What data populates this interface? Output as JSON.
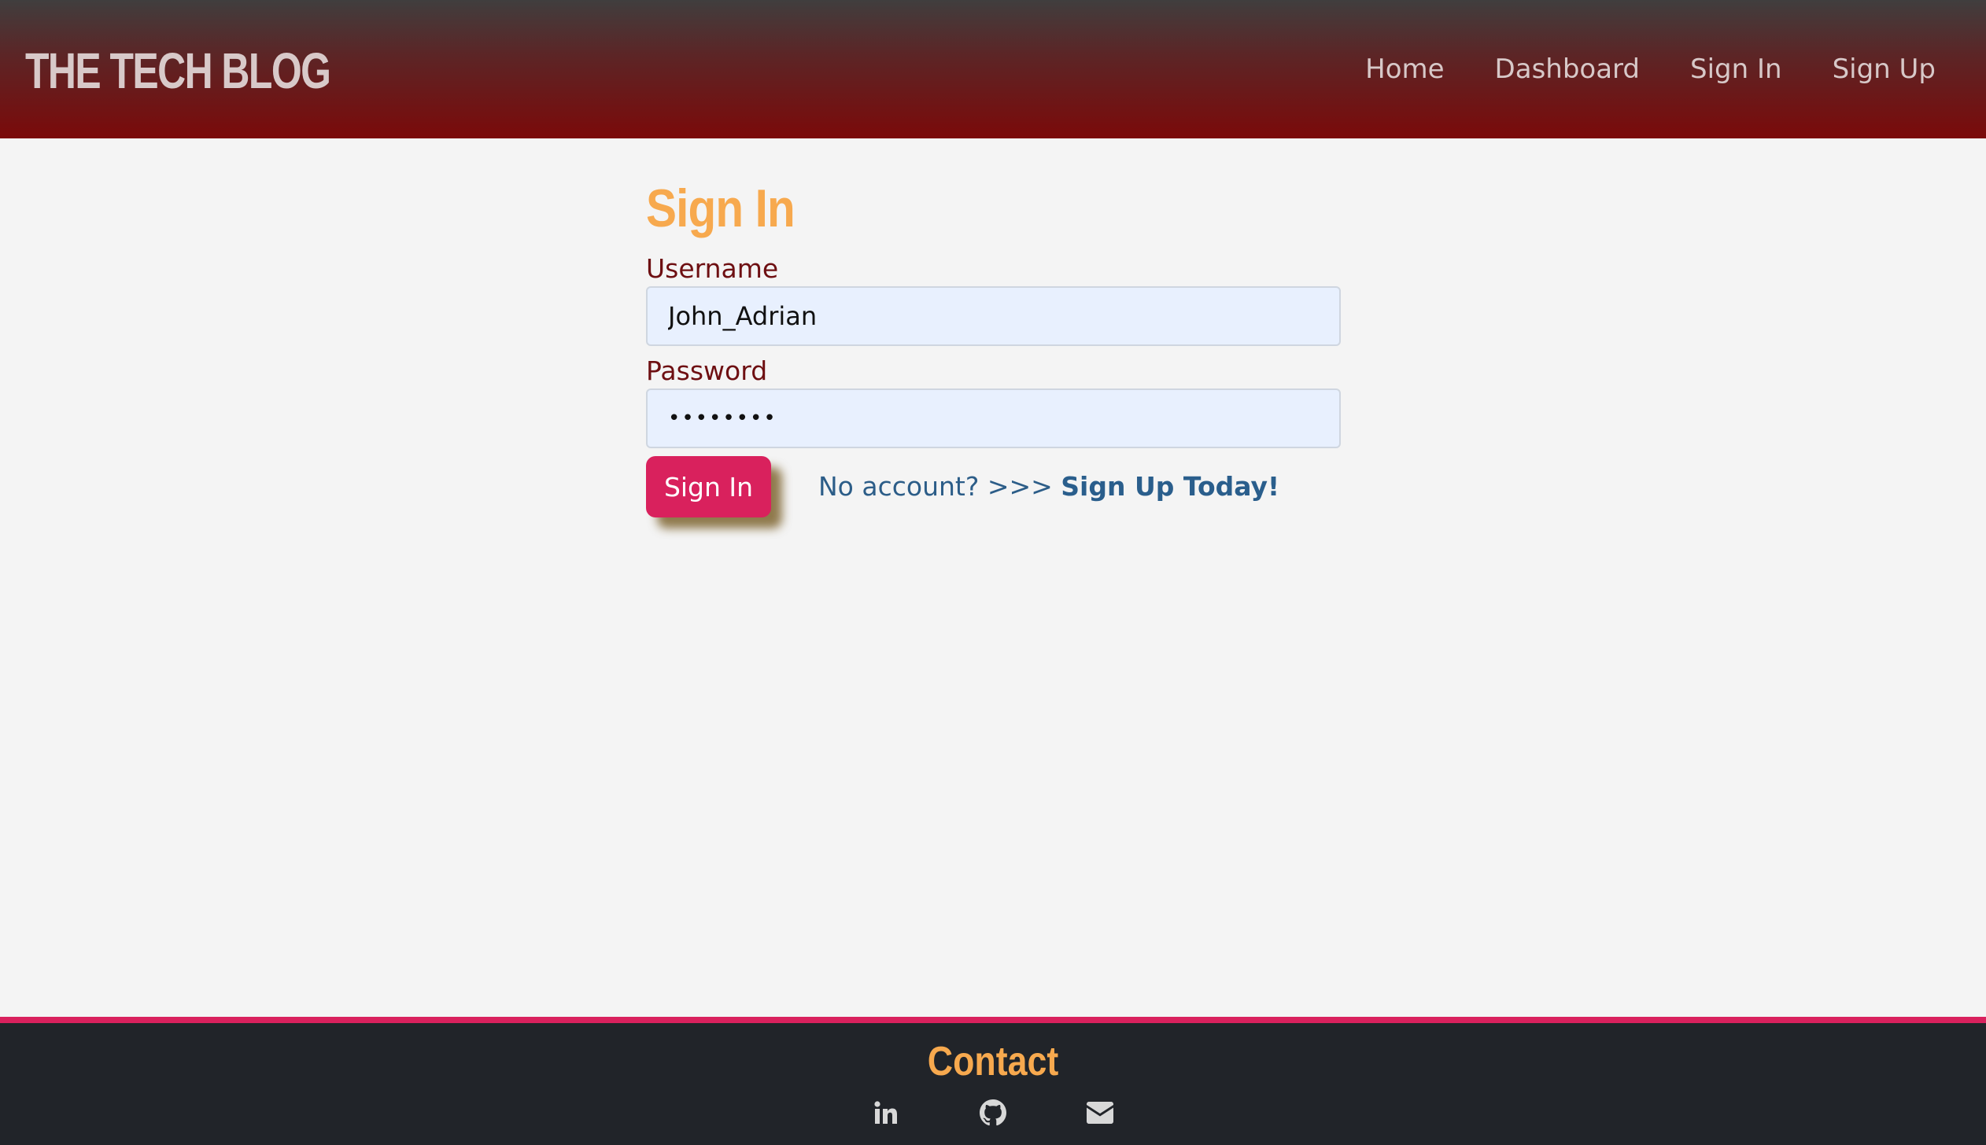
{
  "header": {
    "brand": "THE TECH BLOG",
    "nav": [
      {
        "label": "Home"
      },
      {
        "label": "Dashboard"
      },
      {
        "label": "Sign In"
      },
      {
        "label": "Sign Up"
      }
    ]
  },
  "form": {
    "title": "Sign In",
    "username_label": "Username",
    "username_value": "John_Adrian",
    "password_label": "Password",
    "password_value": "••••••••",
    "submit_label": "Sign In",
    "no_account_text": "No account? >>> ",
    "signup_link": "Sign Up Today!"
  },
  "footer": {
    "title": "Contact",
    "icons": [
      "linkedin-icon",
      "github-icon",
      "envelope-icon"
    ]
  },
  "colors": {
    "header_top": "#403e3e",
    "header_bottom": "#7b0a0a",
    "accent_orange": "#f7a94e",
    "button_pink": "#d9215d",
    "link_blue": "#2a5e8c",
    "footer_bg": "#212429"
  }
}
